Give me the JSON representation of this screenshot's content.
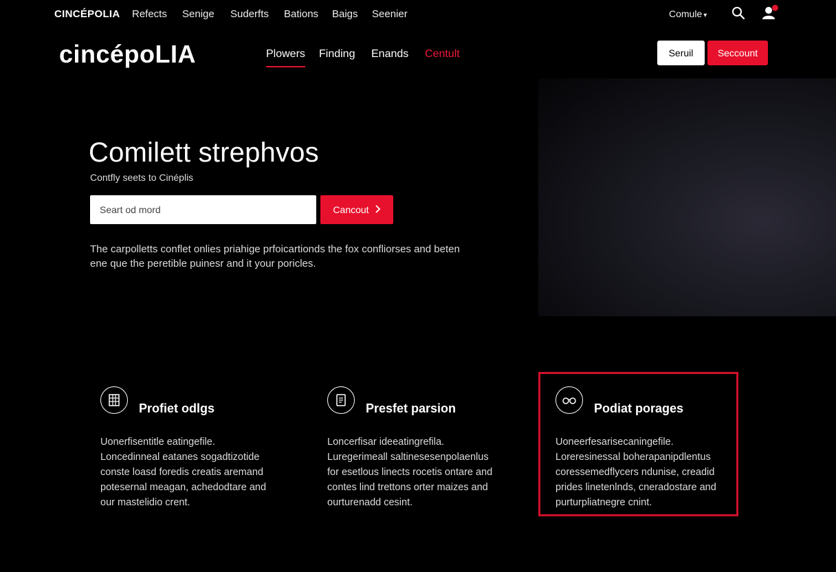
{
  "topbar": {
    "brand": "CINCÉPOLIA",
    "links": [
      "Refects",
      "Senige",
      "Suderfts",
      "Bations",
      "Baigs",
      "Seenier"
    ],
    "locale": "Comule",
    "search_icon": "search-icon",
    "user_icon": "user-icon",
    "notification_color": "#e0142b"
  },
  "header": {
    "logo": "cincépoLIA",
    "nav": [
      "Plowers",
      "Finding",
      "Enands",
      "Centult"
    ],
    "btn_outline": "Seruil",
    "btn_primary": "Seccount"
  },
  "hero": {
    "title": "Comilett strephvos",
    "subtitle": "Contfly seets to Cinéplis",
    "search_placeholder": "Seart od mord",
    "search_button": "Cancout",
    "desc_lines": [
      "The carpolletts conflet onlies priahige prfoicartionds the fox confliorses and beten",
      "ene que the peretible puinesr and it your poricles."
    ]
  },
  "features": [
    {
      "icon": "grid-building-icon",
      "title": "Profiet odlgs",
      "lines": [
        "Uonerfisentitle eatingefile.",
        "Loncedinneal eatanes sogadtizotide",
        "conste loasd foredis creatis aremand",
        "potesernal meagan, achedodtare and",
        "our mastelidio crent."
      ]
    },
    {
      "icon": "document-icon",
      "title": "Presfet parsion",
      "lines": [
        "Loncerfisar ideeatingrefila.",
        "Luregerimeall saltinesesenpolaenlus",
        "for esetlous linects rocetis ontare and",
        "contes lind trettons orter maizes and",
        "ourturenadd cesint."
      ]
    },
    {
      "icon": "glasses-icon",
      "title": "Podiat porages",
      "lines": [
        "Uoneerfesarisecaningefile.",
        "Loreresinessal boherapanipdlentus",
        "coressemedflycers ndunise, creadid",
        "prides linetenlnds, cneradostare and",
        "purturpliatnegre cnint."
      ]
    }
  ],
  "colors": {
    "accent": "#e8112d",
    "highlight_border": "#d0102a"
  }
}
